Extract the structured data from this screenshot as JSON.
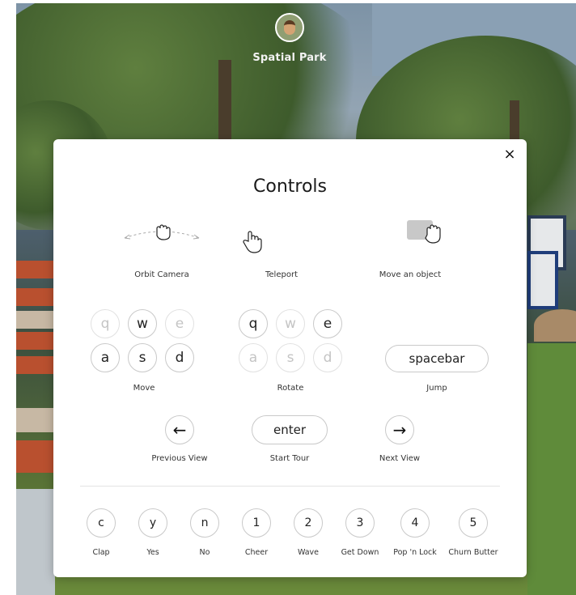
{
  "header": {
    "space_name": "Spatial Park"
  },
  "controls": {
    "title": "Controls",
    "close_label": "×",
    "mouse_actions": [
      {
        "label": "Orbit Camera",
        "icon": "hand-drag-icon"
      },
      {
        "label": "Teleport",
        "icon": "hand-pointer-icon"
      },
      {
        "label": "Move an object",
        "icon": "hand-grab-icon"
      }
    ],
    "move": {
      "label": "Move",
      "keys": [
        "q",
        "w",
        "e",
        "a",
        "s",
        "d"
      ],
      "active": [
        false,
        true,
        false,
        true,
        true,
        true
      ]
    },
    "rotate": {
      "label": "Rotate",
      "keys": [
        "q",
        "w",
        "e",
        "a",
        "s",
        "d"
      ],
      "active": [
        true,
        false,
        true,
        false,
        false,
        false
      ]
    },
    "jump": {
      "label": "Jump",
      "key": "spacebar"
    },
    "previous_view": {
      "label": "Previous View",
      "key": "←"
    },
    "start_tour": {
      "label": "Start Tour",
      "key": "enter"
    },
    "next_view": {
      "label": "Next View",
      "key": "→"
    },
    "emotes": [
      {
        "key": "c",
        "label": "Clap"
      },
      {
        "key": "y",
        "label": "Yes"
      },
      {
        "key": "n",
        "label": "No"
      },
      {
        "key": "1",
        "label": "Cheer"
      },
      {
        "key": "2",
        "label": "Wave"
      },
      {
        "key": "3",
        "label": "Get Down"
      },
      {
        "key": "4",
        "label": "Pop 'n Lock"
      },
      {
        "key": "5",
        "label": "Churn Butter"
      }
    ]
  }
}
